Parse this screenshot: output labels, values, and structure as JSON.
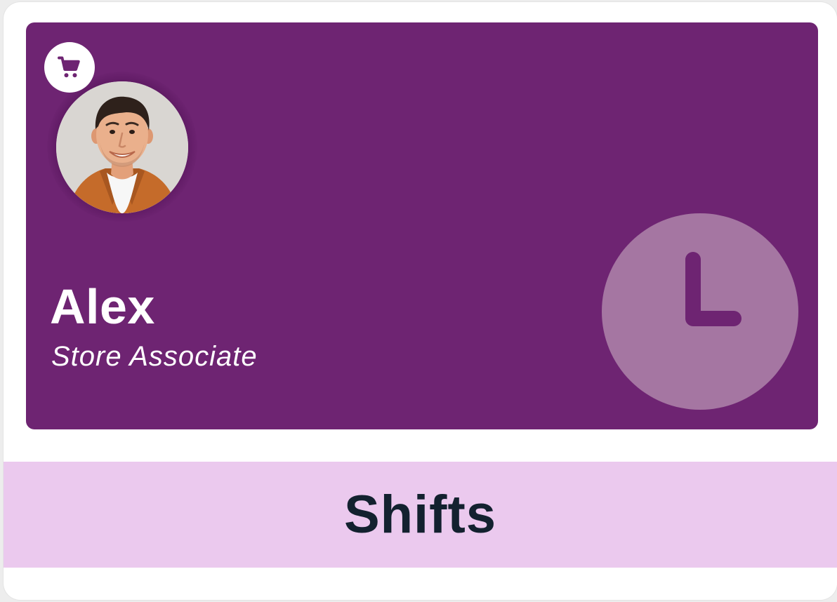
{
  "card": {
    "user_name": "Alex",
    "user_role": "Store Associate",
    "title": "Shifts"
  },
  "icons": {
    "role_badge": "shopping-cart-icon",
    "feature": "clock-icon",
    "avatar": "user-photo"
  },
  "colors": {
    "hero_background": "#6e2472",
    "clock_circle": "#a576a2",
    "footer_background": "#ebc9ee",
    "footer_text": "#13212f"
  }
}
